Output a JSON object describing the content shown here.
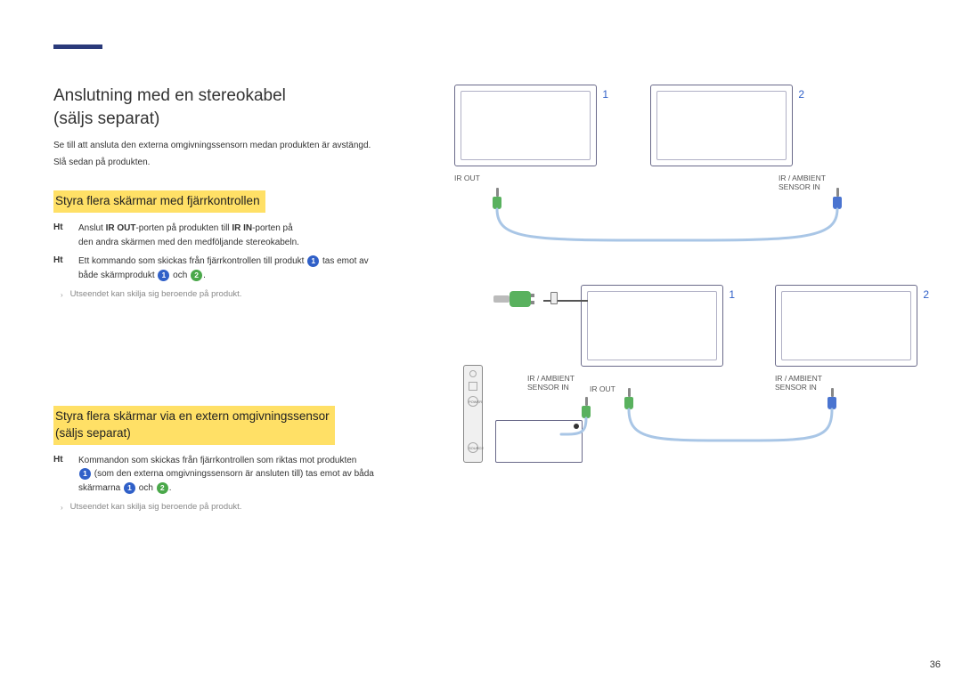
{
  "section1": {
    "title_line1": "Anslutning med en stereokabel",
    "title_line2": "(säljs separat)",
    "intro1": "Se till att ansluta den externa omgivningssensorn medan produkten är avstängd.",
    "intro2": "Slå sedan på produkten.",
    "sub_title": "Styra flera skärmar med fjärrkontrollen",
    "bullet1_label": "Ht",
    "bullet1_text_a": "Anslut ",
    "bullet1_text_b": "-porten på produkten till ",
    "bullet1_text_c": "-porten på",
    "bullet1_text_d": "den andra skärmen med den medföljande stereokabeln.",
    "bullet2_label": "Ht",
    "bullet2_text_a": "Ett kommando som skickas från fjärrkontrollen till produkt ",
    "bullet2_text_b": " tas emot av",
    "bullet2_text_c": "både skärmprodukt ",
    "bullet2_text_d": " och ",
    "bullet2_text_e": ".",
    "note": "Utseendet kan skilja sig beroende på produkt."
  },
  "section2": {
    "sub_title_line1": "Styra flera skärmar via en extern omgivningssensor",
    "sub_title_line2": "(säljs separat)",
    "bullet1_label": "Ht",
    "bullet1_text_a": "Kommandon som skickas från fjärrkontrollen som riktas mot produkten",
    "bullet1_text_b": " (som den externa omgivningssensorn är ansluten till) tas emot av båda",
    "bullet1_text_c": "skärmarna ",
    "bullet1_text_d": " och ",
    "bullet1_text_e": ".",
    "note": "Utseendet kan skilja sig beroende på produkt."
  },
  "diagram": {
    "num1": "1",
    "num2": "2",
    "ir_out": "IR OUT",
    "ir_ambient_line1": "IR / AMBIENT",
    "ir_ambient_line2": "SENSOR IN",
    "remote_power": "POWER",
    "remote_source": "SOURCE"
  },
  "page_number": "36"
}
